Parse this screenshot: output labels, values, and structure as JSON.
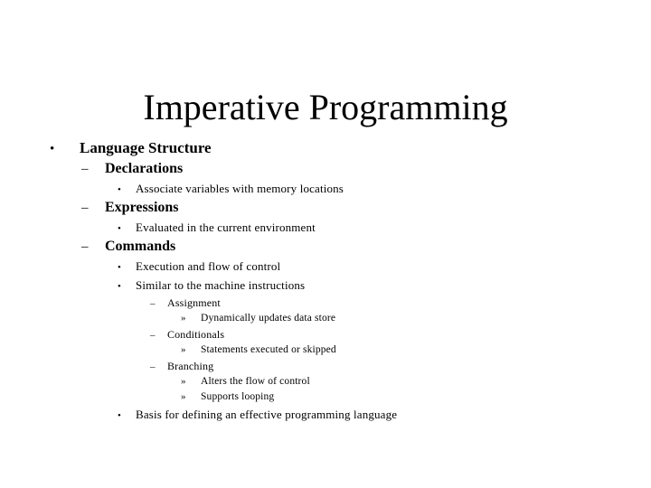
{
  "slide": {
    "title": "Imperative Programming",
    "background_color": "#ffffff",
    "text_color": "#000000",
    "bullet_glyphs": {
      "level1": "•",
      "level2": "–",
      "level3": "•",
      "level4": "–",
      "level5": "»"
    },
    "outline": [
      {
        "level": 1,
        "bullet": "•",
        "text": "Language Structure"
      },
      {
        "level": 2,
        "bullet": "–",
        "text": "Declarations"
      },
      {
        "level": 3,
        "bullet": "•",
        "text": "Associate variables with memory locations"
      },
      {
        "level": 2,
        "bullet": "–",
        "text": "Expressions"
      },
      {
        "level": 3,
        "bullet": "•",
        "text": "Evaluated in the current environment"
      },
      {
        "level": 2,
        "bullet": "–",
        "text": "Commands"
      },
      {
        "level": 3,
        "bullet": "•",
        "text": "Execution and flow of control"
      },
      {
        "level": 3,
        "bullet": "•",
        "text": "Similar to the machine instructions"
      },
      {
        "level": 4,
        "bullet": "–",
        "text": "Assignment"
      },
      {
        "level": 5,
        "bullet": "»",
        "text": "Dynamically updates data store"
      },
      {
        "level": 4,
        "bullet": "–",
        "text": "Conditionals"
      },
      {
        "level": 5,
        "bullet": "»",
        "text": "Statements executed or skipped"
      },
      {
        "level": 4,
        "bullet": "–",
        "text": "Branching"
      },
      {
        "level": 5,
        "bullet": "»",
        "text": "Alters the flow of control"
      },
      {
        "level": 5,
        "bullet": "»",
        "text": "Supports looping"
      },
      {
        "level": 3,
        "bullet": "•",
        "text": "Basis for defining an effective programming language"
      }
    ]
  }
}
